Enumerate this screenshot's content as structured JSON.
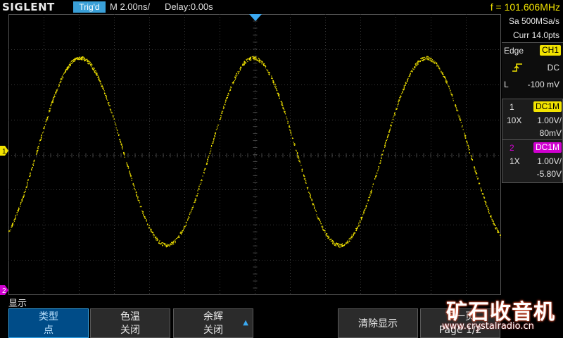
{
  "header": {
    "brand": "SIGLENT",
    "trigger_status": "Trig'd",
    "timebase": "M 2.00ns/",
    "delay": "Delay:0.00s",
    "frequency": "f = 101.606MHz"
  },
  "side": {
    "sample_rate": "Sa 500MSa/s",
    "current_points": "Curr 14.0pts",
    "trigger": {
      "type": "Edge",
      "source": "CH1",
      "slope_icon": "rising-edge-icon",
      "coupling": "DC",
      "level_label": "L",
      "level": "-100 mV"
    },
    "ch1": {
      "number": "1",
      "coupling": "DC1M",
      "probe": "10X",
      "scale": "1.00V/",
      "offset": "80mV"
    },
    "ch2": {
      "number": "2",
      "coupling": "DC1M",
      "probe": "1X",
      "scale": "1.00V/",
      "offset": "-5.80V"
    }
  },
  "markers": {
    "ch1": "1",
    "ch2": "2"
  },
  "menu": {
    "title": "显示",
    "softkeys": [
      {
        "line1": "类型",
        "line2": "点"
      },
      {
        "line1": "色温",
        "line2": "关闭"
      },
      {
        "line1": "余辉",
        "line2": "关闭"
      },
      {
        "line1": "清除显示",
        "line2": ""
      },
      {
        "line1": "下一页",
        "line2": "Page 1/2"
      }
    ]
  },
  "watermark": {
    "title": "矿石收音机",
    "url": "www.crystalradio.cn"
  },
  "colors": {
    "ch1": "#f2e300",
    "ch2": "#d000d0",
    "accent": "#3aa0d8",
    "grid": "#3a3a3a"
  }
}
